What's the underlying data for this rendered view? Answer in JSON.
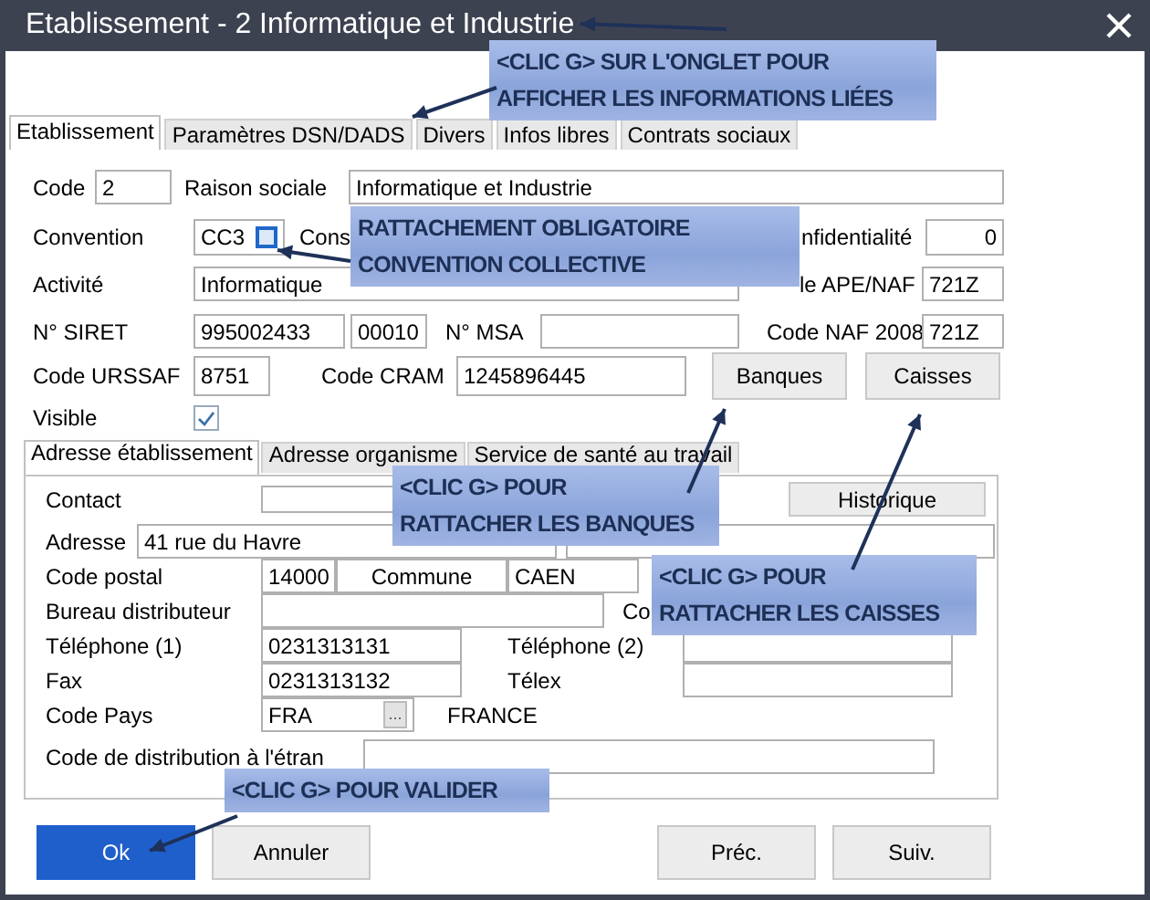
{
  "window": {
    "title": "Etablissement - 2 Informatique et Industrie"
  },
  "tabs": [
    {
      "label": "Etablissement",
      "selected": true
    },
    {
      "label": "Paramètres DSN/DADS",
      "selected": false
    },
    {
      "label": "Divers",
      "selected": false
    },
    {
      "label": "Infos libres",
      "selected": false
    },
    {
      "label": "Contrats sociaux",
      "selected": false
    }
  ],
  "general": {
    "code": {
      "label": "Code",
      "value": "2"
    },
    "raison_sociale": {
      "label": "Raison sociale",
      "value": "Informatique et Industrie"
    },
    "convention": {
      "label": "Convention",
      "value": "CC3"
    },
    "convention_libelle": {
      "label": "Cons"
    },
    "confidentialite": {
      "label": "nfidentialité",
      "value": "0"
    },
    "activite": {
      "label": "Activité",
      "value": "Informatique"
    },
    "code_ape": {
      "label": "le APE/NAF",
      "value": "721Z"
    },
    "siret": {
      "label": "N° SIRET",
      "value": "995002433",
      "value_2": "00010"
    },
    "msa": {
      "label": "N° MSA"
    },
    "naf_2008": {
      "label": "Code NAF 2008",
      "value": "721Z"
    },
    "urssaf": {
      "label": "Code URSSAF",
      "value": "8751"
    },
    "cram": {
      "label": "Code CRAM",
      "value": "1245896445"
    },
    "visible": {
      "label": "Visible",
      "checked": true
    }
  },
  "side_buttons": [
    "Banques",
    "Caisses"
  ],
  "address_tabs": [
    {
      "label": "Adresse établissement",
      "selected": true
    },
    {
      "label": "Adresse organisme",
      "selected": false
    },
    {
      "label": "Service de santé au travail",
      "selected": false
    }
  ],
  "address": {
    "contact": {
      "label": "Contact"
    },
    "historique_button": "Historique",
    "adresse": {
      "label": "Adresse",
      "value": "41 rue du Havre"
    },
    "code_postal": {
      "label": "Code postal",
      "value": "14000"
    },
    "commune": {
      "label": "Commune",
      "value": "CAEN"
    },
    "bureau": {
      "label": "Bureau distributeur"
    },
    "co": {
      "label": "Co"
    },
    "telephone_1": {
      "label": "Téléphone (1)",
      "value": "0231313131"
    },
    "telephone_2": {
      "label": "Téléphone (2)"
    },
    "fax": {
      "label": "Fax",
      "value": "0231313132"
    },
    "telex": {
      "label": "Télex"
    },
    "pays": {
      "label": "Code Pays",
      "value": "FRA",
      "browse": "...",
      "name": "FRANCE"
    },
    "distribution": {
      "label": "Code de distribution à l'étran"
    }
  },
  "buttons": [
    {
      "label": "Ok",
      "kind": "primary"
    },
    {
      "label": "Annuler",
      "kind": "normal"
    },
    {
      "label": "Préc.",
      "kind": "normal"
    },
    {
      "label": "Suiv.",
      "kind": "normal"
    }
  ],
  "callouts": [
    {
      "lines": [
        "<CLIC G> SUR L'ONGLET POUR",
        "AFFICHER LES INFORMATIONS LIÉES"
      ]
    },
    {
      "lines": [
        "RATTACHEMENT OBLIGATOIRE",
        "CONVENTION COLLECTIVE"
      ]
    },
    {
      "lines": [
        "<CLIC G> POUR",
        "RATTACHER LES BANQUES"
      ]
    },
    {
      "lines": [
        "<CLIC G> POUR",
        "RATTACHER LES CAISSES"
      ]
    },
    {
      "lines": [
        "<CLIC G> POUR VALIDER"
      ]
    }
  ]
}
